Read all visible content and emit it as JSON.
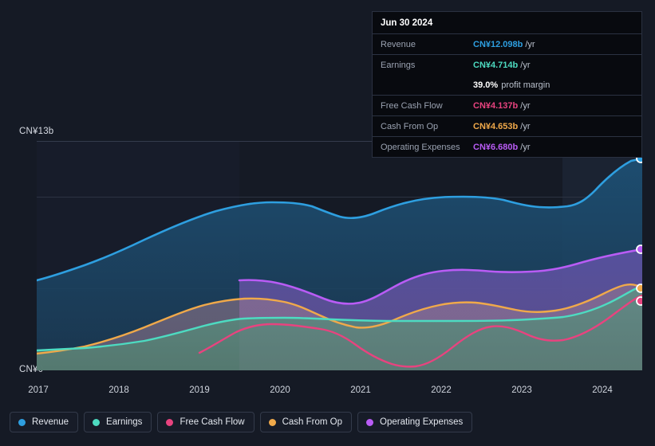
{
  "tooltip": {
    "title": "Jun 30 2024",
    "rows": [
      {
        "label": "Revenue",
        "value": "CN¥12.098b",
        "unit": "/yr",
        "color": "#2e9fe0"
      },
      {
        "label": "Earnings",
        "value": "CN¥4.714b",
        "unit": "/yr",
        "color": "#4ddbc1"
      },
      {
        "label": "",
        "value": "39.0%",
        "unit": "profit margin",
        "color": "#ffffff"
      },
      {
        "label": "Free Cash Flow",
        "value": "CN¥4.137b",
        "unit": "/yr",
        "color": "#e8437f"
      },
      {
        "label": "Cash From Op",
        "value": "CN¥4.653b",
        "unit": "/yr",
        "color": "#f0a94a"
      },
      {
        "label": "Operating Expenses",
        "value": "CN¥6.680b",
        "unit": "/yr",
        "color": "#b95cf5"
      }
    ]
  },
  "axis": {
    "y_top_label": "CN¥13b",
    "y_bottom_label": "CN¥0",
    "x_ticks": [
      "2017",
      "2018",
      "2019",
      "2020",
      "2021",
      "2022",
      "2023",
      "2024"
    ]
  },
  "legend": {
    "items": [
      {
        "label": "Revenue",
        "color": "#2e9fe0"
      },
      {
        "label": "Earnings",
        "color": "#4ddbc1"
      },
      {
        "label": "Free Cash Flow",
        "color": "#e8437f"
      },
      {
        "label": "Cash From Op",
        "color": "#f0a94a"
      },
      {
        "label": "Operating Expenses",
        "color": "#b95cf5"
      }
    ]
  },
  "chart_data": {
    "type": "area",
    "title": "",
    "xlabel": "",
    "ylabel": "CN¥",
    "ylim": [
      0,
      13
    ],
    "grid": true,
    "legend_position": "bottom",
    "x": [
      "2017",
      "2017.5",
      "2018",
      "2018.5",
      "2019",
      "2019.5",
      "2020",
      "2020.5",
      "2021",
      "2021.5",
      "2022",
      "2022.5",
      "2023",
      "2023.5",
      "2024",
      "2024.5"
    ],
    "series": [
      {
        "name": "Revenue",
        "color": "#2e9fe0",
        "values": [
          5.1,
          5.45,
          5.95,
          6.55,
          7.2,
          7.8,
          8.45,
          8.7,
          8.55,
          8.9,
          9.35,
          9.7,
          9.75,
          9.5,
          9.55,
          12.098
        ]
      },
      {
        "name": "Earnings",
        "color": "#4ddbc1",
        "values": [
          1.13,
          1.15,
          1.18,
          1.22,
          1.3,
          1.55,
          1.95,
          2.12,
          2.15,
          2.1,
          2.12,
          2.22,
          2.25,
          2.25,
          2.6,
          4.714
        ]
      },
      {
        "name": "Free Cash Flow",
        "color": "#e8437f",
        "values": [
          null,
          null,
          null,
          null,
          1.0,
          1.75,
          2.15,
          2.2,
          1.05,
          0.2,
          1.4,
          2.3,
          1.9,
          1.55,
          2.3,
          4.137
        ]
      },
      {
        "name": "Cash From Op",
        "color": "#f0a94a",
        "values": [
          0.95,
          1.05,
          1.2,
          1.45,
          1.85,
          2.3,
          2.65,
          2.55,
          2.1,
          1.65,
          2.3,
          2.8,
          2.4,
          2.25,
          2.9,
          4.653
        ]
      },
      {
        "name": "Operating Expenses",
        "color": "#b95cf5",
        "values": [
          null,
          null,
          null,
          null,
          null,
          5.1,
          4.95,
          4.6,
          4.3,
          4.75,
          5.45,
          5.6,
          5.55,
          5.65,
          6.1,
          6.68
        ]
      }
    ],
    "highlight_bands": [
      {
        "from": "2017",
        "to": "2019.5",
        "note": "earnings-shade"
      },
      {
        "from": "2023.5",
        "to": "2024.5",
        "note": "recent-period-shade"
      }
    ]
  }
}
